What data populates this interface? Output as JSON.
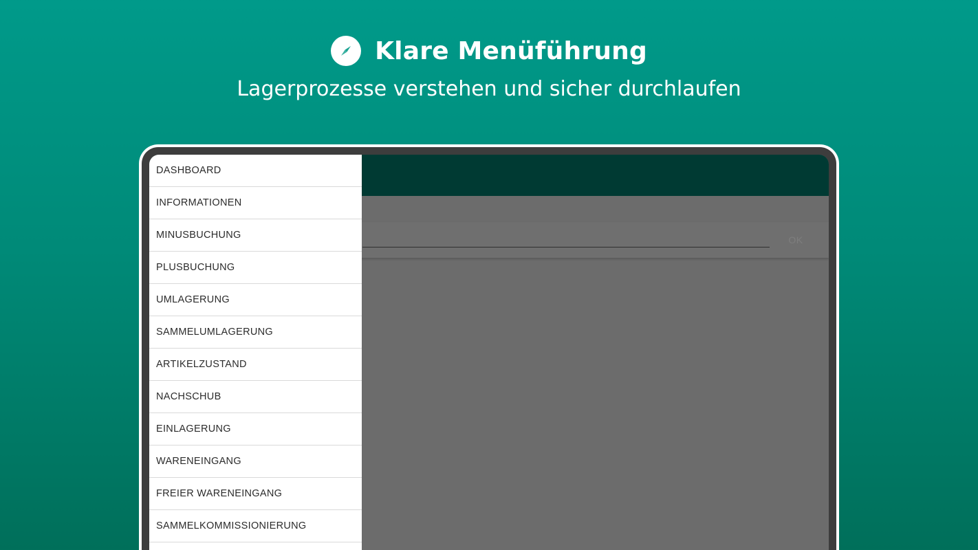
{
  "header": {
    "icon": "compass-icon",
    "title": "Klare Menüführung",
    "subtitle": "Lagerprozesse verstehen und sicher durchlaufen"
  },
  "app": {
    "ok_label": "OK",
    "menu": [
      "DASHBOARD",
      "INFORMATIONEN",
      "MINUSBUCHUNG",
      "PLUSBUCHUNG",
      "UMLAGERUNG",
      "SAMMELUMLAGERUNG",
      "ARTIKELZUSTAND",
      "NACHSCHUB",
      "EINLAGERUNG",
      "WARENEINGANG",
      "FREIER WARENEINGANG",
      "SAMMELKOMMISSIONIERUNG"
    ]
  },
  "colors": {
    "background_top": "#009a8a",
    "background_bottom": "#006f5a",
    "appbar": "#003a33",
    "scrim": "#6c6c6c",
    "drawer": "#ffffff"
  }
}
